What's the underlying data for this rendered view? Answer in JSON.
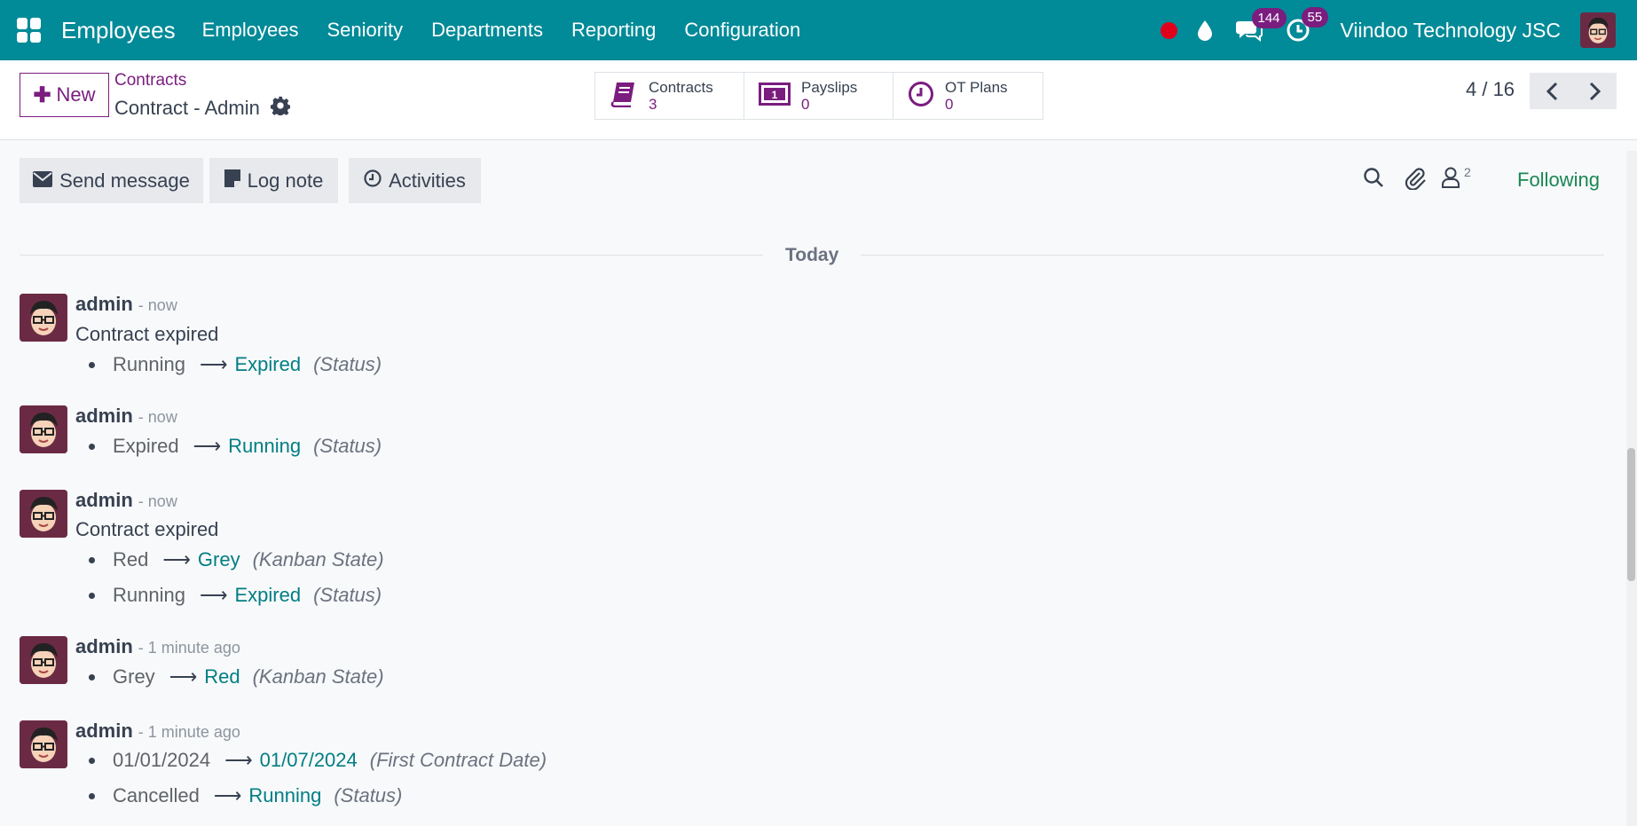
{
  "topnav": {
    "app_title": "Employees",
    "menu": [
      "Employees",
      "Seniority",
      "Departments",
      "Reporting",
      "Configuration"
    ],
    "messages_badge": "144",
    "activities_badge": "55",
    "company": "Viindoo Technology JSC"
  },
  "control": {
    "new_label": "New",
    "breadcrumb_parent": "Contracts",
    "breadcrumb_current": "Contract - Admin",
    "smart_buttons": [
      {
        "label": "Contracts",
        "value": "3",
        "icon": "book-icon"
      },
      {
        "label": "Payslips",
        "value": "0",
        "icon": "money-icon"
      },
      {
        "label": "OT Plans",
        "value": "0",
        "icon": "clock-icon"
      }
    ],
    "pager": "4 / 16"
  },
  "chatter": {
    "send_message": "Send message",
    "log_note": "Log note",
    "activities": "Activities",
    "followers_count": "2",
    "following": "Following",
    "date_separator": "Today",
    "messages": [
      {
        "author": "admin",
        "time": "- now",
        "body": "Contract expired",
        "changes": [
          {
            "old": "Running",
            "new": "Expired",
            "field": "(Status)"
          }
        ]
      },
      {
        "author": "admin",
        "time": "- now",
        "body": "",
        "changes": [
          {
            "old": "Expired",
            "new": "Running",
            "field": "(Status)"
          }
        ]
      },
      {
        "author": "admin",
        "time": "- now",
        "body": "Contract expired",
        "changes": [
          {
            "old": "Red",
            "new": "Grey",
            "field": "(Kanban State)"
          },
          {
            "old": "Running",
            "new": "Expired",
            "field": "(Status)"
          }
        ]
      },
      {
        "author": "admin",
        "time": "- 1 minute ago",
        "body": "",
        "changes": [
          {
            "old": "Grey",
            "new": "Red",
            "field": "(Kanban State)"
          }
        ]
      },
      {
        "author": "admin",
        "time": "- 1 minute ago",
        "body": "",
        "changes": [
          {
            "old": "01/01/2024",
            "new": "01/07/2024",
            "field": "(First Contract Date)"
          },
          {
            "old": "Cancelled",
            "new": "Running",
            "field": "(Status)"
          }
        ]
      }
    ]
  },
  "colors": {
    "navbar": "#018a98",
    "primary": "#7a1d7f",
    "link": "#017e84",
    "following": "#198754"
  }
}
